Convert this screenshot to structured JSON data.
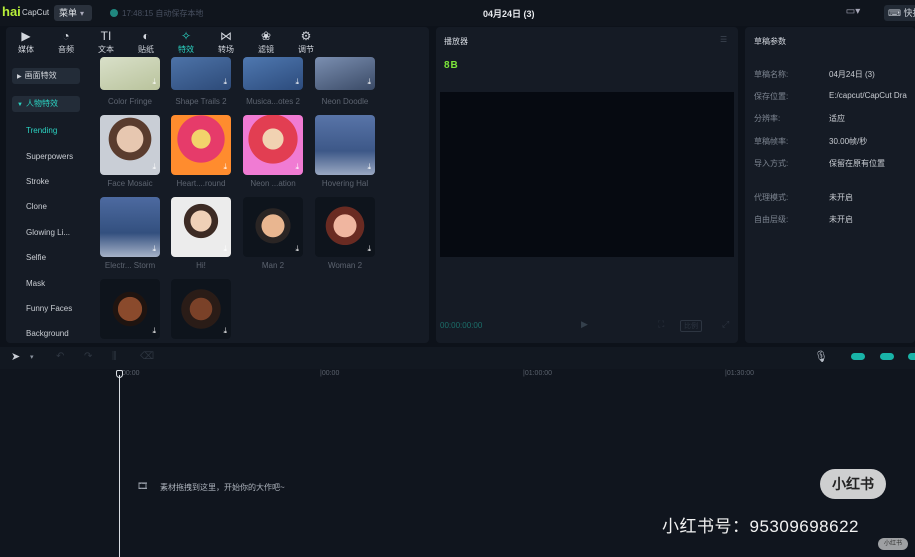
{
  "app": {
    "logo": "hai",
    "name": "CapCut",
    "menu_label": "菜单",
    "autosave_text": "17:48:15 自动保存本地",
    "project_title": "04月24日 (3)",
    "shortcut_label": "快捷"
  },
  "toolbar": {
    "tabs": [
      {
        "label": "媒体",
        "icon": "media-icon"
      },
      {
        "label": "音频",
        "icon": "audio-icon"
      },
      {
        "label": "文本",
        "icon": "text-icon"
      },
      {
        "label": "贴纸",
        "icon": "sticker-icon"
      },
      {
        "label": "特效",
        "icon": "effects-icon"
      },
      {
        "label": "转场",
        "icon": "transition-icon"
      },
      {
        "label": "滤镜",
        "icon": "filter-icon"
      },
      {
        "label": "调节",
        "icon": "adjust-icon"
      }
    ],
    "active_tab": "特效"
  },
  "sidebar": {
    "groups": [
      "画面特效",
      "人物特效"
    ],
    "items": [
      "Trending",
      "Superpowers",
      "Stroke",
      "Clone",
      "Glowing Li...",
      "Selfie",
      "Mask",
      "Funny Faces",
      "Background"
    ],
    "active_item": "Trending"
  },
  "effects": [
    {
      "label": "Color Fringe"
    },
    {
      "label": "Shape Trails 2"
    },
    {
      "label": "Musica...otes 2"
    },
    {
      "label": "Neon Doodle"
    },
    {
      "label": "Face Mosaic"
    },
    {
      "label": "Heart....round"
    },
    {
      "label": "Neon ...ation"
    },
    {
      "label": "Hovering Hal"
    },
    {
      "label": "Electr... Storm"
    },
    {
      "label": "Hi!"
    },
    {
      "label": "Man 2"
    },
    {
      "label": "Woman 2"
    },
    {
      "label": ""
    },
    {
      "label": ""
    }
  ],
  "player": {
    "title": "播放器",
    "logo_text": "8B",
    "timecode": "00:00:00:00",
    "ratio_label": "比例"
  },
  "draft": {
    "title": "草稿参数",
    "rows": [
      {
        "key": "草稿名称:",
        "value": "04月24日 (3)"
      },
      {
        "key": "保存位置:",
        "value": "E:/capcut/CapCut Dra"
      },
      {
        "key": "分辨率:",
        "value": "适应"
      },
      {
        "key": "草稿帧率:",
        "value": "30.00帧/秒"
      },
      {
        "key": "导入方式:",
        "value": "保留在原有位置"
      },
      {
        "key": "代理模式:",
        "value": "未开启"
      },
      {
        "key": "自由层级:",
        "value": "未开启"
      }
    ]
  },
  "timeline": {
    "ticks": [
      "00:00",
      "|00:00",
      "|01:00:00",
      "|01:30:00"
    ],
    "drop_hint": "素材拖拽到这里，开始你的大作吧~"
  },
  "watermark": {
    "badge": "小红书",
    "id_text": "小红书号：95309698622",
    "corner": "小红书"
  },
  "colors": {
    "accent": "#2bd3c2",
    "background": "#0d121a",
    "panel": "#151b25"
  }
}
